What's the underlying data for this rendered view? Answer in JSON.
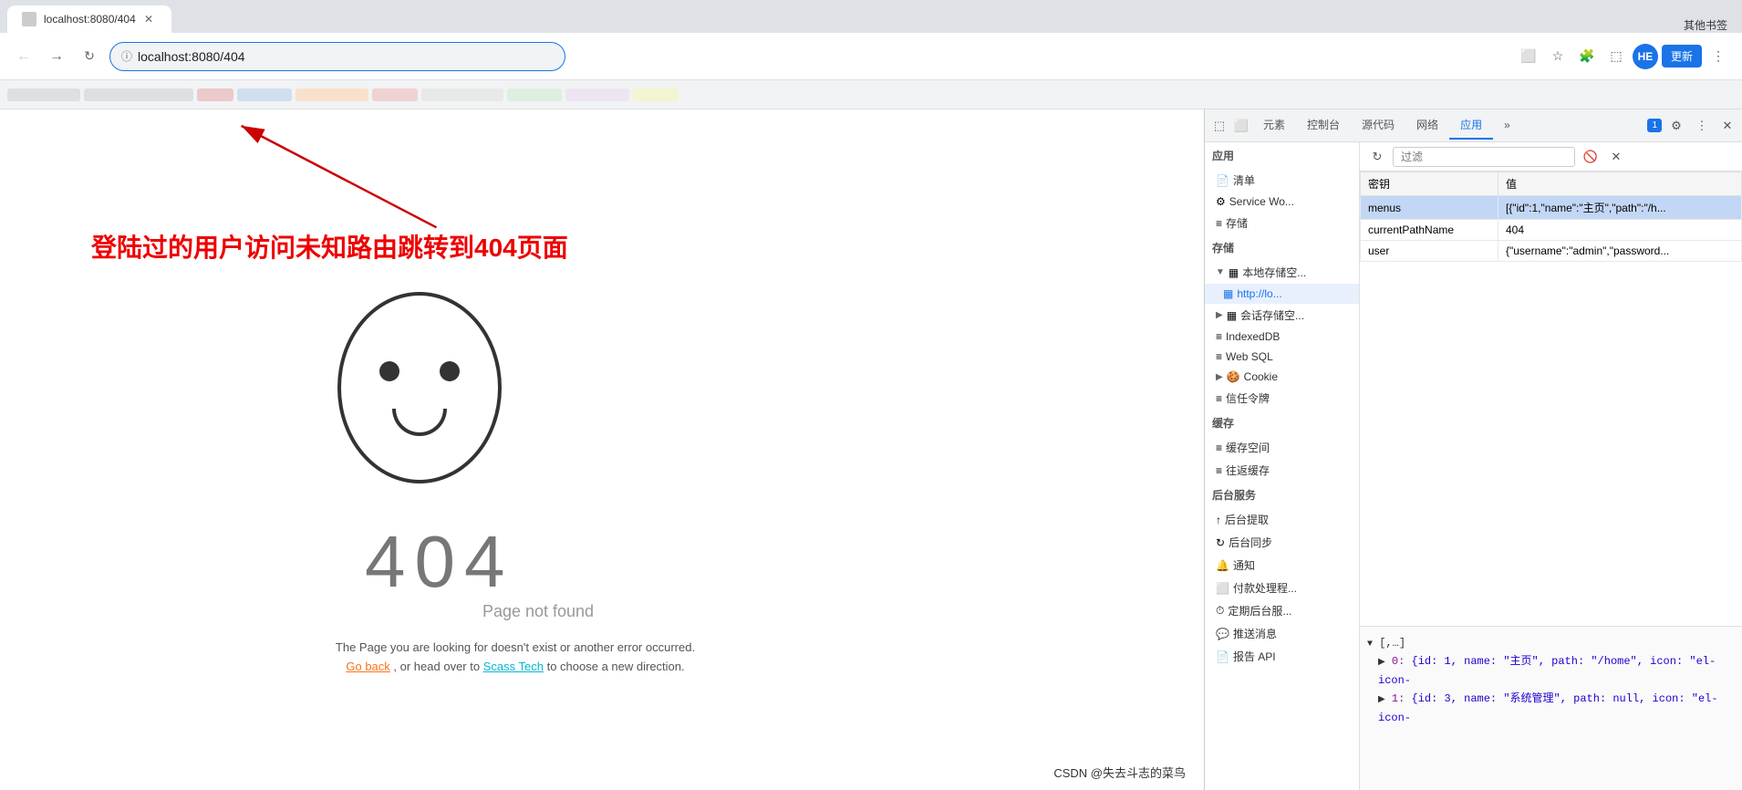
{
  "browser": {
    "address": "localhost:8080/404",
    "tab_label": "localhost:8080/404",
    "update_btn": "更新",
    "profile_initial": "HE",
    "bookmarks_label": "其他书签"
  },
  "devtools": {
    "tabs": [
      {
        "label": "元素",
        "active": false
      },
      {
        "label": "控制台",
        "active": false
      },
      {
        "label": "源代码",
        "active": false
      },
      {
        "label": "网络",
        "active": false
      },
      {
        "label": "应用",
        "active": true
      },
      {
        "label": "»",
        "active": false
      }
    ],
    "badge": "1",
    "filter_placeholder": "过滤",
    "app_sidebar": {
      "sections": [
        {
          "title": "应用",
          "items": [
            {
              "label": "清单",
              "icon": "📄",
              "level": 0
            },
            {
              "label": "Service Wo...",
              "icon": "⚙️",
              "level": 0
            },
            {
              "label": "存储",
              "icon": "≡",
              "level": 0
            }
          ]
        },
        {
          "title": "存储",
          "items": [
            {
              "label": "本地存储空...",
              "icon": "▦",
              "level": 0,
              "expanded": true
            },
            {
              "label": "http://lo...",
              "icon": "▦",
              "level": 1
            },
            {
              "label": "会话存储空...",
              "icon": "▦",
              "level": 0,
              "has_arrow": true
            },
            {
              "label": "IndexedDB",
              "icon": "≡",
              "level": 0
            },
            {
              "label": "Web SQL",
              "icon": "≡",
              "level": 0
            },
            {
              "label": "Cookie",
              "icon": "▶",
              "level": 0,
              "has_arrow": true
            },
            {
              "label": "信任令牌",
              "icon": "≡",
              "level": 0
            }
          ]
        },
        {
          "title": "缓存",
          "items": [
            {
              "label": "缓存空间",
              "icon": "≡",
              "level": 0
            },
            {
              "label": "往返缓存",
              "icon": "≡",
              "level": 0
            }
          ]
        },
        {
          "title": "后台服务",
          "items": [
            {
              "label": "后台提取",
              "icon": "↑",
              "level": 0
            },
            {
              "label": "后台同步",
              "icon": "↻",
              "level": 0
            },
            {
              "label": "通知",
              "icon": "🔔",
              "level": 0
            },
            {
              "label": "付款处理程...",
              "icon": "⬜",
              "level": 0
            },
            {
              "label": "定期后台服...",
              "icon": "⏱",
              "level": 0
            },
            {
              "label": "推送消息",
              "icon": "💬",
              "level": 0
            },
            {
              "label": "报告 API",
              "icon": "📄",
              "level": 0
            }
          ]
        }
      ]
    },
    "storage_table": {
      "columns": [
        "密钥",
        "值"
      ],
      "rows": [
        {
          "key": "menus",
          "value": "[{\"id\":1,\"name\":\"主页\",\"path\":\"/h...",
          "selected": true
        },
        {
          "key": "currentPathName",
          "value": "404"
        },
        {
          "key": "user",
          "value": "{\"username\":\"admin\",\"password..."
        }
      ]
    },
    "value_pane": {
      "label": "▼ [,…]",
      "items": [
        {
          "index": "0",
          "value": "{id: 1, name: \"主页\", path: \"/home\", icon: \"el-icon-"
        },
        {
          "index": "1",
          "value": "{id: 3, name: \"系统管理\", path: null, icon: \"el-icon-"
        }
      ]
    }
  },
  "page_404": {
    "annotation": "登陆过的用户访问未知路由跳转到404页面",
    "error_code": "404",
    "page_not_found": "Page not found",
    "description_line1": "The Page you are looking for doesn't exist or another error occurred.",
    "description_line2_prefix": "",
    "go_back": "Go back",
    "description_line2_mid": ", or head over to",
    "scass": "Scass Tech",
    "description_line2_suffix": "to choose a new direction."
  },
  "watermark": "CSDN @失去斗志的菜鸟"
}
